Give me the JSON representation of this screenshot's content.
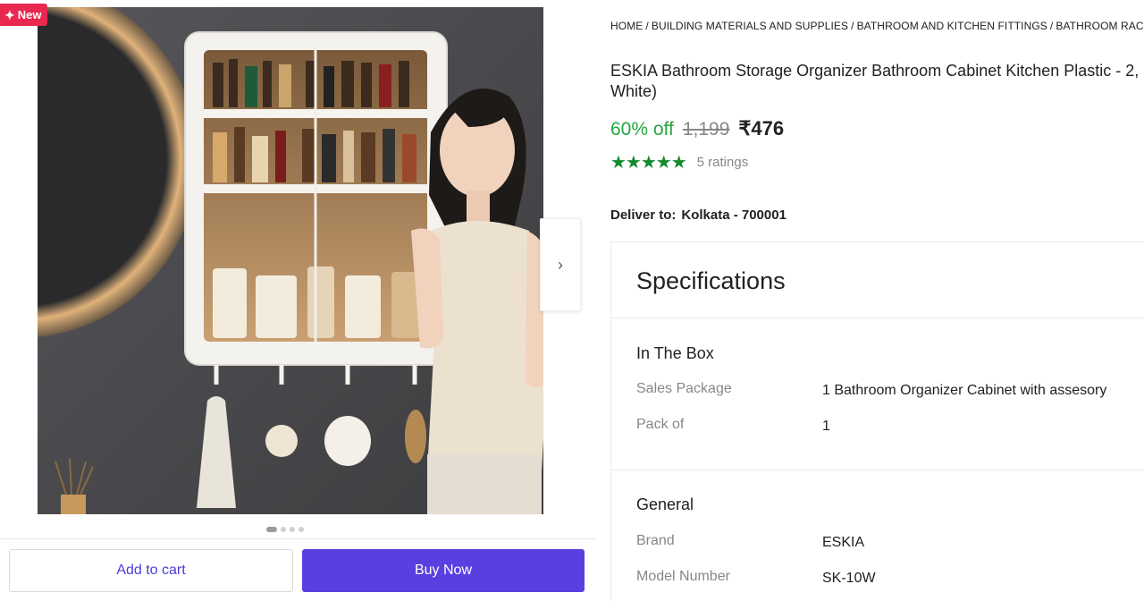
{
  "badge": {
    "label": "New",
    "icon": "sparkle-icon"
  },
  "gallery": {
    "image_alt": "ESKIA bathroom cabinet mounted on wall",
    "dot_count": 4,
    "active_dot": 0,
    "next_icon": "›"
  },
  "actions": {
    "add_to_cart": "Add to cart",
    "buy_now": "Buy Now"
  },
  "breadcrumb": [
    "HOME",
    "BUILDING MATERIALS AND SUPPLIES",
    "BATHROOM AND KITCHEN FITTINGS",
    "BATHROOM RACKS"
  ],
  "product": {
    "title": "ESKIA Bathroom Storage Organizer Bathroom Cabinet Kitchen Plastic - 2, White)",
    "discount": "60% off",
    "mrp": "1,199",
    "price": "₹476",
    "stars": "★★★★★",
    "rating_value": 4.5,
    "ratings_count": "5 ratings"
  },
  "delivery": {
    "label": "Deliver to:",
    "location": "Kolkata - 700001"
  },
  "specifications": {
    "title": "Specifications",
    "groups": [
      {
        "title": "In The Box",
        "rows": [
          {
            "label": "Sales Package",
            "value": "1 Bathroom Organizer Cabinet with assesory"
          },
          {
            "label": "Pack of",
            "value": "1"
          }
        ]
      },
      {
        "title": "General",
        "rows": [
          {
            "label": "Brand",
            "value": "ESKIA"
          },
          {
            "label": "Model Number",
            "value": "SK-10W"
          }
        ]
      }
    ]
  },
  "colors": {
    "accent": "#5a3fe0",
    "discount": "#26a541",
    "stars": "#128a2e",
    "badge": "#e8284f"
  }
}
